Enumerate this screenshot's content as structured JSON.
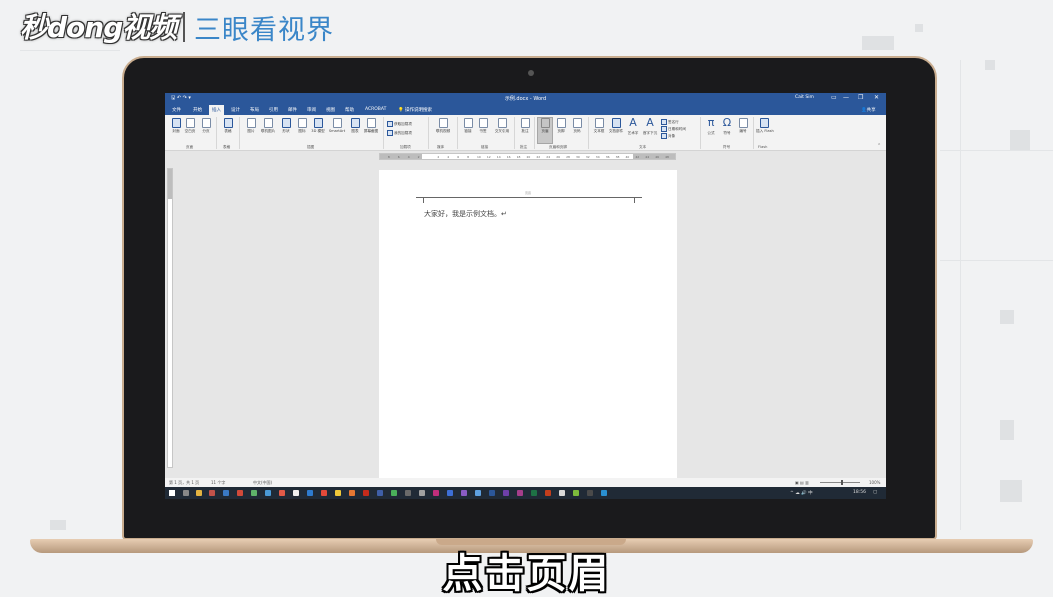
{
  "watermark": {
    "logo": "秒dong视频",
    "brand": "三眼看视界"
  },
  "subtitle": "点击页眉",
  "word": {
    "quick_access": "🖫 ↶ ↷ ▾",
    "title": "示例.docx - Word",
    "user": "Cait Sim",
    "window_buttons": {
      "ribbon_options": "▭",
      "minimize": "—",
      "maximize": "❐",
      "close": "✕"
    },
    "tabs": [
      {
        "label": "文件"
      },
      {
        "label": "开始"
      },
      {
        "label": "插入"
      },
      {
        "label": "设计"
      },
      {
        "label": "布局"
      },
      {
        "label": "引用"
      },
      {
        "label": "邮件"
      },
      {
        "label": "审阅"
      },
      {
        "label": "视图"
      },
      {
        "label": "帮助"
      },
      {
        "label": "ACROBAT"
      }
    ],
    "tell_me": "操作说明搜索",
    "share": "共享",
    "ribbon": {
      "pages": {
        "cover": "封面",
        "blank": "空白页",
        "break": "分页",
        "group": "页面"
      },
      "tables": {
        "table": "表格",
        "group": "表格"
      },
      "illustrations": {
        "pictures": "图片",
        "online_pictures": "联机图片",
        "shapes": "形状",
        "icons": "图标",
        "model3d": "3D 模型",
        "smartart": "SmartArt",
        "chart": "图表",
        "screenshot": "屏幕截图",
        "group": "插图"
      },
      "addins": {
        "get": "获取加载项",
        "mine": "我的加载项",
        "group": "加载项"
      },
      "media": {
        "online_video": "联机视频",
        "group": "媒体"
      },
      "links": {
        "link": "链接",
        "bookmark": "书签",
        "cross_ref": "交叉引用",
        "group": "链接"
      },
      "comments": {
        "comment": "批注",
        "group": "批注"
      },
      "header_footer": {
        "header": "页眉",
        "footer": "页脚",
        "page_number": "页码",
        "group": "页眉和页脚"
      },
      "text": {
        "textbox": "文本框",
        "quick_parts": "文档部件",
        "wordart": "艺术字",
        "dropcap": "首字下沉",
        "signature": "签名行",
        "datetime": "日期和时间",
        "object": "对象",
        "group": "文本"
      },
      "symbols": {
        "equation": "公式",
        "symbol": "符号",
        "number": "编号",
        "group": "符号"
      },
      "flash": {
        "insert": "插入 Flash",
        "group": "Flash"
      }
    },
    "ruler_marks": [
      "8",
      "6",
      "4",
      "2",
      "",
      "2",
      "4",
      "6",
      "8",
      "10",
      "12",
      "14",
      "16",
      "18",
      "20",
      "22",
      "24",
      "26",
      "28",
      "30",
      "32",
      "34",
      "36",
      "38",
      "40",
      "42",
      "44",
      "46",
      "48"
    ],
    "document": {
      "header_label": "页眉",
      "body": "大家好，我是示例文档。↵"
    },
    "statusbar": {
      "page": "第 1 页，共 1 页",
      "words": "11 个字",
      "lang": "中文(中国)",
      "zoom": "100%"
    },
    "taskbar": {
      "tray_text": "^ ☁ 🔊 中",
      "clock": "18:56"
    }
  },
  "colors": {
    "word_blue": "#2b579a",
    "subtitle_text": "#ffffff",
    "brand_blue": "#3a86c8"
  }
}
